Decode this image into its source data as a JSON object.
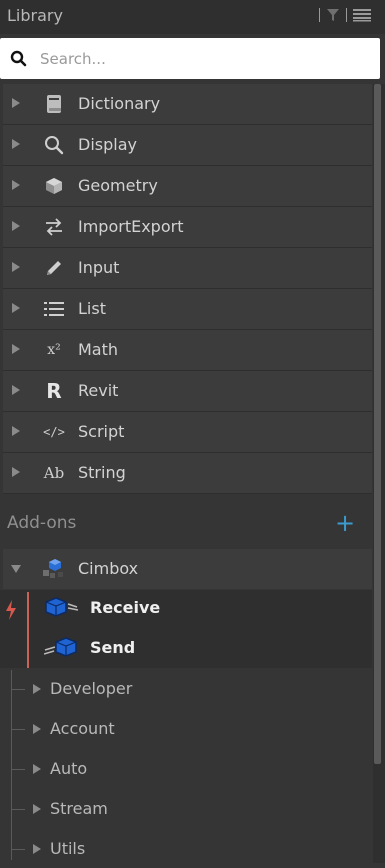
{
  "header": {
    "title": "Library"
  },
  "search": {
    "placeholder": "Search..."
  },
  "categories": [
    {
      "label": "Dictionary",
      "icon": "dictionary-book-icon"
    },
    {
      "label": "Display",
      "icon": "magnifier-icon"
    },
    {
      "label": "Geometry",
      "icon": "cube-icon"
    },
    {
      "label": "ImportExport",
      "icon": "swap-arrows-icon"
    },
    {
      "label": "Input",
      "icon": "pencil-icon"
    },
    {
      "label": "List",
      "icon": "list-icon"
    },
    {
      "label": "Math",
      "icon": "x-squared-icon",
      "glyph": "x²"
    },
    {
      "label": "Revit",
      "icon": "revit-r-icon",
      "glyph": "R"
    },
    {
      "label": "Script",
      "icon": "code-tag-icon",
      "glyph": "</>"
    },
    {
      "label": "String",
      "icon": "ab-text-icon",
      "glyph": "Ab"
    }
  ],
  "addons": {
    "label": "Add-ons",
    "package": {
      "label": "Cimbox",
      "members": [
        {
          "label": "Receive"
        },
        {
          "label": "Send"
        }
      ],
      "subcategories": [
        {
          "label": "Developer"
        },
        {
          "label": "Account"
        },
        {
          "label": "Auto"
        },
        {
          "label": "Stream"
        },
        {
          "label": "Utils"
        }
      ]
    }
  },
  "colors": {
    "accent": "#3a9bd1",
    "member_marker": "#c7645a",
    "panel": "#3c3c3c"
  }
}
